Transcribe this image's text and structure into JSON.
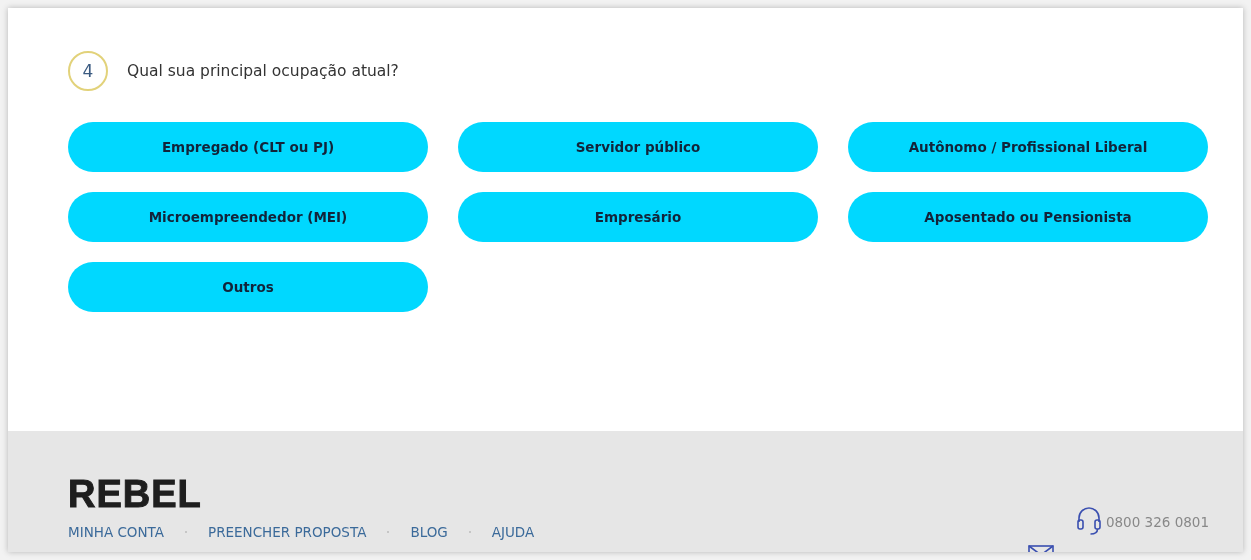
{
  "question": {
    "number": "4",
    "text": "Qual sua principal ocupação atual?"
  },
  "options": [
    {
      "label": "Empregado (CLT ou PJ)",
      "selected": false
    },
    {
      "label": "Servidor público",
      "selected": false
    },
    {
      "label": "Autônomo / Profissional Liberal",
      "selected": false
    },
    {
      "label": "Microempreendedor (MEI)",
      "selected": false
    },
    {
      "label": "Empresário",
      "selected": false
    },
    {
      "label": "Aposentado ou Pensionista",
      "selected": false
    },
    {
      "label": "Outros",
      "selected": false
    }
  ],
  "footer": {
    "logo": "REBEL",
    "links": [
      "MINHA CONTA",
      "PREENCHER PROPOSTA",
      "BLOG",
      "AJUDA"
    ],
    "phone": "0800 326 0801"
  }
}
